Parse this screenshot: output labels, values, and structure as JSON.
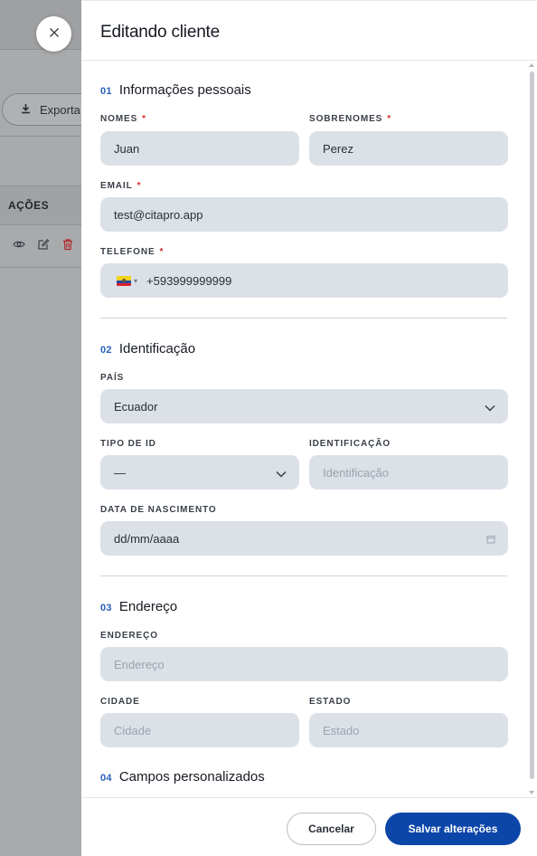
{
  "background": {
    "export_label": "Exporta",
    "table_header": "AÇÕES"
  },
  "drawer": {
    "title": "Editando cliente",
    "sections": {
      "personal": {
        "num": "01",
        "label": "Informações pessoais"
      },
      "identification": {
        "num": "02",
        "label": "Identificação"
      },
      "address": {
        "num": "03",
        "label": "Endereço"
      },
      "custom": {
        "num": "04",
        "label": "Campos personalizados"
      }
    },
    "fields": {
      "first_name": {
        "label": "NOMES",
        "required": "*",
        "value": "Juan"
      },
      "last_name": {
        "label": "SOBRENOMES",
        "required": "*",
        "value": "Perez"
      },
      "email": {
        "label": "EMAIL",
        "required": "*",
        "value": "test@citapro.app"
      },
      "phone": {
        "label": "TELEFONE",
        "required": "*",
        "value": "+593999999999",
        "country_flag": "ecuador-flag-icon"
      },
      "country": {
        "label": "PAÍS",
        "value": "Ecuador"
      },
      "id_type": {
        "label": "TIPO DE ID",
        "value": "—"
      },
      "id_number": {
        "label": "IDENTIFICAÇÃO",
        "placeholder": "Identificação"
      },
      "birth_date": {
        "label": "DATA DE NASCIMENTO",
        "value": "dd/mm/aaaa"
      },
      "address": {
        "label": "ENDEREÇO",
        "placeholder": "Endereço"
      },
      "city": {
        "label": "CIDADE",
        "placeholder": "Cidade"
      },
      "state": {
        "label": "ESTADO",
        "placeholder": "Estado"
      }
    },
    "footer": {
      "cancel_label": "Cancelar",
      "save_label": "Salvar alterações"
    }
  },
  "colors": {
    "accent": "#0c46a8",
    "section_number": "#2960b8",
    "required": "#d42a2a",
    "field_bg": "#dce1e8"
  }
}
